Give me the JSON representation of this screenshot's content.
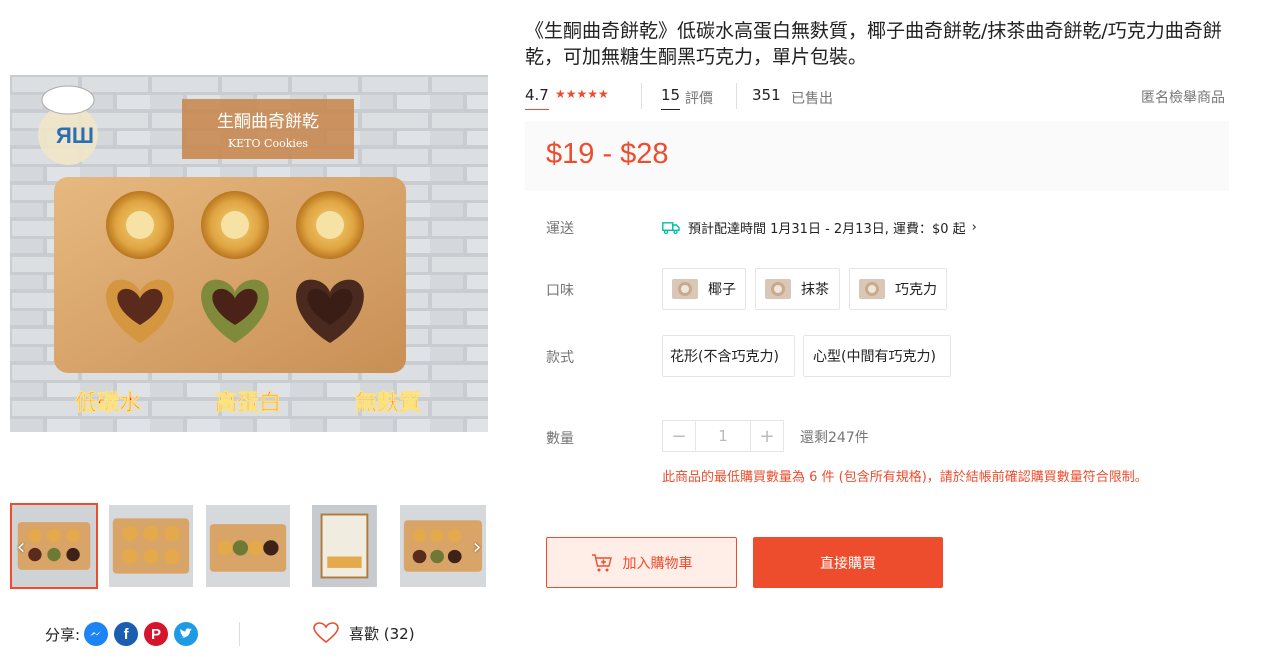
{
  "product": {
    "title": "《生酮曲奇餅乾》低碳水高蛋白無麩質，椰子曲奇餅乾/抹茶曲奇餅乾/巧克力曲奇餅乾，可加無糖生酮黑巧克力，單片包裝。",
    "rating": "4.7",
    "review_count": "15",
    "review_label": "評價",
    "sold_count": "351",
    "sold_label": "已售出",
    "report_label": "匿名檢舉商品",
    "price": "$19 - $28"
  },
  "image": {
    "banner_zh": "生酮曲奇餅乾",
    "banner_en": "KETO Cookies",
    "caption_1": "低碳水",
    "caption_2": "高蛋白",
    "caption_3": "無麩質"
  },
  "thumbnails": {
    "prev_icon": "chevron-left-icon",
    "next_icon": "chevron-right-icon",
    "count": 5,
    "active_index": 0
  },
  "share": {
    "label": "分享:",
    "networks": [
      "messenger",
      "facebook",
      "pinterest",
      "twitter"
    ],
    "like_label": "喜歡 (32)"
  },
  "shipping": {
    "label": "運送",
    "text": "預計配達時間 1月31日 - 2月13日, 運費：$0 起",
    "icon": "truck-icon"
  },
  "flavor": {
    "label": "口味",
    "options": [
      "椰子",
      "抹茶",
      "巧克力"
    ]
  },
  "style": {
    "label": "款式",
    "options": [
      "花形(不含巧克力)",
      "心型(中間有巧克力)"
    ]
  },
  "quantity": {
    "label": "數量",
    "value": "1",
    "minus": "−",
    "plus": "+",
    "stock": "還剩247件",
    "warning": "此商品的最低購買數量為 6 件 (包含所有規格)，請於結帳前確認購買數量符合限制。"
  },
  "actions": {
    "add_to_cart": "加入購物車",
    "buy_now": "直接購買"
  },
  "colors": {
    "accent": "#ee4d2d",
    "accent_bg": "#ffeee8",
    "price_bg": "#fafafa"
  }
}
